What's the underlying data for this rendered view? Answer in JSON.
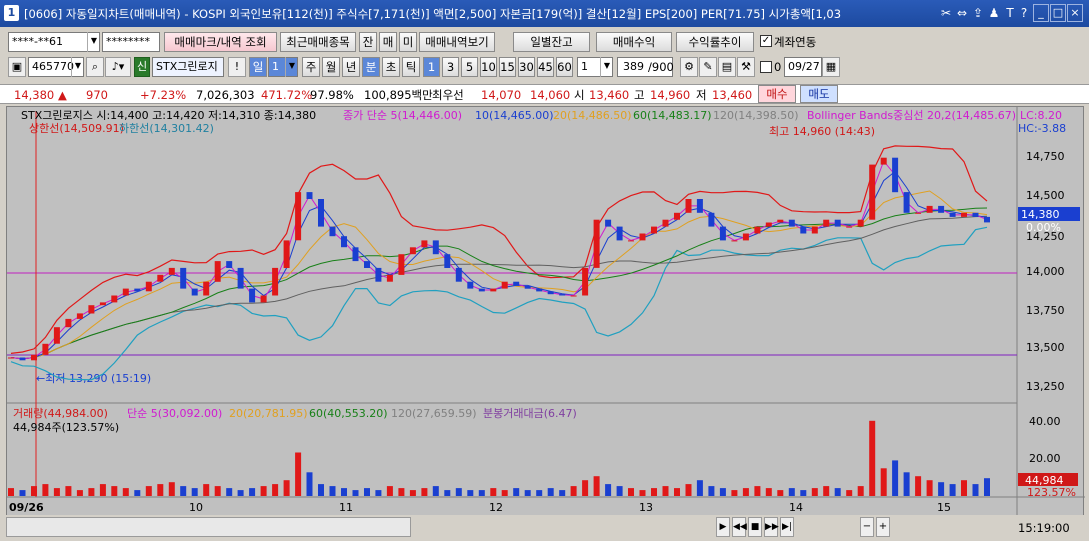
{
  "title": {
    "number": "1",
    "text": "[0606] 자동일지차트(매매내역) - KOSPI 외국인보유[112(천)] 주식수[7,171(천)] 액면[2,500] 자본금[179(억)] 결산[12월] EPS[200] PER[71.75] 시가총액[1,03"
  },
  "toolbar1": {
    "account": "****-**61",
    "password": "********",
    "btn_trade_mark": "매매마크/내역 조회",
    "btn_recent": "최근매매종목",
    "btn_jan": "잔",
    "btn_mae": "매",
    "btn_mi": "미",
    "btn_history": "매매내역보기",
    "btn_daily": "일별잔고",
    "btn_profit": "매매수익",
    "btn_return": "수익률추이",
    "link_label": "계좌연동"
  },
  "toolbar2": {
    "code": "465770",
    "stock_name": "STX그린로지",
    "period_sel": "일",
    "period_num": "1",
    "periods": [
      "주",
      "월",
      "년",
      "분",
      "초",
      "틱"
    ],
    "intervals": [
      "1",
      "3",
      "5",
      "10",
      "15",
      "30",
      "45",
      "60"
    ],
    "count": "1",
    "page": "389",
    "page_total": "/900",
    "d_value": "0",
    "date": "09/27"
  },
  "quote": {
    "price": "14,380",
    "change": "970",
    "change_pct": "+7.23%",
    "volume": "7,026,303",
    "vol_pct": "471.72%",
    "strength": "97.98%",
    "amount": "100,895백만",
    "best_bid_label": "최우선",
    "best_ask": "14,070",
    "best_bid": "14,060",
    "low_label": "시",
    "open": "13,460",
    "high_label": "고",
    "high": "14,960",
    "low2_label": "저",
    "low": "13,460",
    "buy_btn": "매수",
    "sell_btn": "매도"
  },
  "chart_data": {
    "type": "line",
    "title": "STX그린로지스 시:14,400 고:14,420 저:14,310 종:14,380",
    "indicators": [
      {
        "name": "종가 단순 5(14,446.00)",
        "color": "#d01ad0"
      },
      {
        "name": "10(14,465.00)",
        "color": "#1a3fd0"
      },
      {
        "name": "20(14,486.50)",
        "color": "#e0a020"
      },
      {
        "name": "60(14,483.17)",
        "color": "#188018"
      },
      {
        "name": "120(14,398.50)",
        "color": "#808080"
      },
      {
        "name": "Bollinger Bands중심선 20,2(14,485.67)",
        "color": "#d01ad0"
      }
    ],
    "bb_upper_label": "상한선(14,509.91)",
    "bb_lower_label": "하한선(14,301.42)",
    "lc_label": "LC:8.20",
    "hc_label": "HC:-3.88",
    "high_marker": "최고 14,960 (14:43)",
    "low_marker": "←최저 13,290 (15:19)",
    "y_ticks": [
      "14,750",
      "14,500",
      "14,250",
      "14,000",
      "13,750",
      "13,500",
      "13,250"
    ],
    "current_price_tag": "14,380",
    "current_pct_tag": "0.00%",
    "x_labels": [
      "09/26",
      "10",
      "11",
      "12",
      "13",
      "14",
      "15"
    ],
    "ylim": [
      13150,
      15000
    ],
    "close_series": [
      13400,
      13380,
      13420,
      13500,
      13620,
      13680,
      13720,
      13780,
      13800,
      13850,
      13900,
      13880,
      13950,
      14000,
      14050,
      13900,
      13850,
      13950,
      14100,
      14050,
      13900,
      13800,
      13850,
      14050,
      14250,
      14600,
      14550,
      14350,
      14280,
      14200,
      14100,
      14050,
      13950,
      14000,
      14150,
      14200,
      14250,
      14150,
      14050,
      13950,
      13900,
      13880,
      13900,
      13950,
      13920,
      13900,
      13880,
      13860,
      13850,
      13850,
      14050,
      14400,
      14350,
      14250,
      14250,
      14300,
      14350,
      14400,
      14450,
      14550,
      14450,
      14350,
      14250,
      14250,
      14300,
      14350,
      14380,
      14400,
      14350,
      14300,
      14350,
      14400,
      14350,
      14350,
      14400,
      14800,
      14850,
      14600,
      14450,
      14450,
      14500,
      14450,
      14420,
      14450,
      14420,
      14380
    ],
    "volume_panel": {
      "title": "거래량(44,984.00)",
      "ma_labels": [
        "단순 5(30,092.00)",
        "20(20,781.95)",
        "60(40,553.20)",
        "120(27,659.59)",
        "분봉거래대금(6.47)"
      ],
      "sub_label": "44,984주(123.57%)",
      "y_ticks": [
        "40.00",
        "20.00"
      ],
      "current_tag": "44,984",
      "current_pct": "123.57%",
      "values": [
        4,
        3,
        5,
        6,
        4,
        5,
        3,
        4,
        6,
        5,
        4,
        3,
        5,
        6,
        7,
        5,
        4,
        6,
        5,
        4,
        3,
        4,
        5,
        6,
        8,
        22,
        12,
        6,
        5,
        4,
        3,
        4,
        3,
        5,
        4,
        3,
        4,
        5,
        3,
        4,
        3,
        3,
        4,
        3,
        4,
        3,
        3,
        4,
        3,
        5,
        8,
        10,
        6,
        5,
        4,
        3,
        4,
        5,
        4,
        6,
        8,
        5,
        4,
        3,
        4,
        5,
        4,
        3,
        4,
        3,
        4,
        5,
        4,
        3,
        5,
        38,
        14,
        18,
        12,
        10,
        8,
        7,
        6,
        8,
        6,
        9
      ],
      "ylim": [
        0,
        45
      ]
    }
  },
  "bottom": {
    "time": "15:19:00"
  }
}
